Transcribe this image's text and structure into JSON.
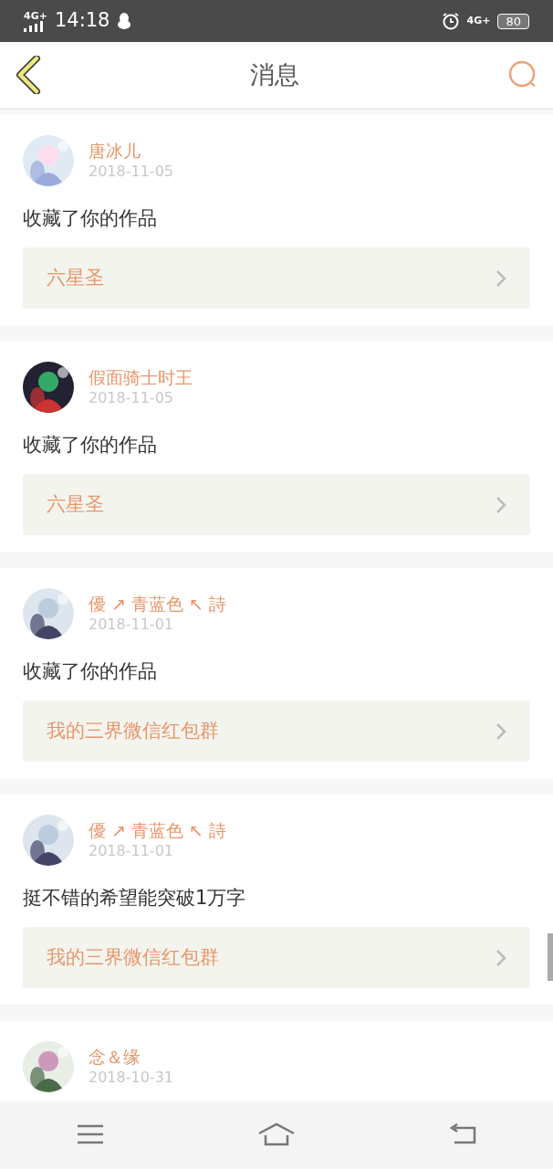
{
  "status_bar": {
    "network": "4G+",
    "time": "14:18",
    "network_right": "4G+",
    "battery": "80"
  },
  "header": {
    "title": "消息"
  },
  "messages": [
    {
      "name": "唐冰儿",
      "date": "2018-11-05",
      "text": "收藏了你的作品",
      "work": "六星圣"
    },
    {
      "name": "假面骑士时王",
      "date": "2018-11-05",
      "text": "收藏了你的作品",
      "work": "六星圣"
    },
    {
      "name": "優 ↗ 青蓝色 ↖ 詩",
      "date": "2018-11-01",
      "text": "收藏了你的作品",
      "work": "我的三界微信红包群"
    },
    {
      "name": "優 ↗ 青蓝色 ↖ 詩",
      "date": "2018-11-01",
      "text": "挺不错的希望能突破1万字",
      "work": "我的三界微信红包群"
    },
    {
      "name": "念＆缘",
      "date": "2018-10-31"
    }
  ]
}
